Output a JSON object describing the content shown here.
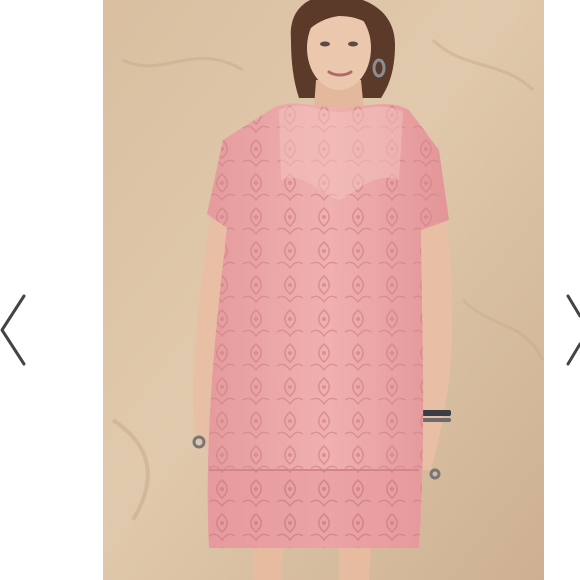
{
  "viewer": {
    "prev_icon": "chevron-left-icon",
    "next_icon": "chevron-right-icon",
    "photo": {
      "subject": "woman-in-pink-lace-shift-dress",
      "colors": {
        "wall": "#dcc3a4",
        "wall_shadow": "#c9ac8b",
        "dress": "#eeaaaa",
        "dress_lace": "#d98c8e",
        "skin": "#e9c3a9",
        "hair": "#5b3a2a",
        "bracelet": "#3c3c44"
      }
    },
    "arrow_color": "#444444"
  }
}
